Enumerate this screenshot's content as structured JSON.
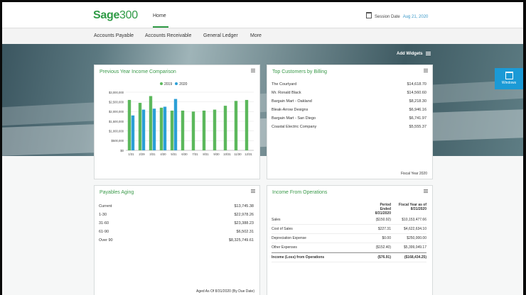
{
  "app": {
    "logo_word": "Sage",
    "logo_num": "300",
    "home_tab": "Home",
    "session_label": "Session Date",
    "session_date": "Aug 21, 2020"
  },
  "nav": {
    "items": [
      "Accounts Payable",
      "Accounts Receivable",
      "General Ledger",
      "More"
    ]
  },
  "toolbar": {
    "add_widgets": "Add Widgets",
    "windows": "Windows"
  },
  "income_comparison": {
    "title": "Previous Year Income Comparison"
  },
  "top_customers": {
    "title": "Top Customers by Billing",
    "rows": [
      {
        "name": "The Courtyard",
        "amount": "$14,618.70"
      },
      {
        "name": "Mr. Ronald Black",
        "amount": "$14,560.60"
      },
      {
        "name": "Bargain Mart - Oakland",
        "amount": "$8,218.30"
      },
      {
        "name": "Bleak-Arrow Designs",
        "amount": "$6,946.16"
      },
      {
        "name": "Bargain Mart - San Diego",
        "amount": "$6,741.97"
      },
      {
        "name": "Coastal Electric Company",
        "amount": "$5,555.37"
      }
    ],
    "footer": "Fiscal Year 2020"
  },
  "payables_aging": {
    "title": "Payables Aging",
    "rows": [
      {
        "label": "Current",
        "amount": "$13,745.38"
      },
      {
        "label": "1-30",
        "amount": "$22,978.26"
      },
      {
        "label": "31-60",
        "amount": "$23,388.23"
      },
      {
        "label": "61-90",
        "amount": "$6,502.31"
      },
      {
        "label": "Over 90",
        "amount": "$8,325,749.61"
      }
    ],
    "footer": "Aged As Of 8/31/2020 (By Due Date)"
  },
  "income_operations": {
    "title": "Income From Operations",
    "col1": "Period\nEnded\n8/31/2020",
    "col2": "Fiscal Year as of\n8/31/2020",
    "rows": [
      {
        "label": "Sales",
        "p": "($150.92)",
        "f": "$10,153,477.66"
      },
      {
        "label": "Cost of Sales",
        "p": "$227.31",
        "f": "$4,622,634.10"
      },
      {
        "label": "Depreciation Expense",
        "p": "$0.00",
        "f": "$250,000.00"
      },
      {
        "label": "Other Expenses",
        "p": "($152.40)",
        "f": "$5,399,049.17"
      }
    ],
    "total": {
      "label": "Income (Loss) from Operations",
      "p": "($76.91)",
      "f": "($168,434.25)"
    }
  },
  "chart_data": {
    "type": "bar",
    "categories": [
      "1/31",
      "2/29",
      "3/31",
      "4/30",
      "5/31",
      "6/30",
      "7/31",
      "8/31",
      "9/30",
      "10/31",
      "11/30",
      "12/31"
    ],
    "series": [
      {
        "name": "2019",
        "color": "#5cb85c",
        "values": [
          2600000,
          2450000,
          2800000,
          2200000,
          2050000,
          2050000,
          2000000,
          2050000,
          2100000,
          2300000,
          2550000,
          2600000
        ]
      },
      {
        "name": "2020",
        "color": "#2b9fd6",
        "values": [
          1800000,
          2100000,
          2150000,
          2250000,
          2650000,
          null,
          null,
          null,
          null,
          null,
          null,
          null
        ]
      }
    ],
    "yticks": [
      "$0",
      "$500,000",
      "$1,000,000",
      "$1,500,000",
      "$2,000,000",
      "$2,500,000",
      "$3,000,000"
    ],
    "ylim": [
      0,
      3000000
    ],
    "legend": "top",
    "grid": true
  }
}
